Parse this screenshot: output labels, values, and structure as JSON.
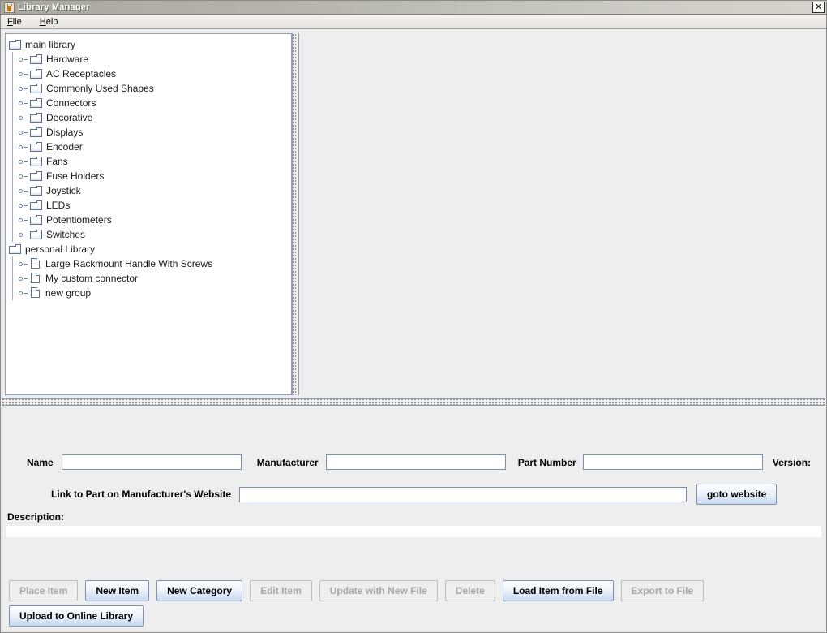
{
  "window": {
    "title": "Library Manager",
    "app_icon": "java-coffee-cup-icon",
    "close_label": "✕"
  },
  "menubar": {
    "items": [
      {
        "label": "File",
        "mnemonic": "F"
      },
      {
        "label": "Help",
        "mnemonic": "H"
      }
    ]
  },
  "tree": {
    "roots": [
      {
        "label": "main library",
        "icon": "folder-icon",
        "children": [
          {
            "label": "Hardware",
            "icon": "folder-icon"
          },
          {
            "label": "AC Receptacles",
            "icon": "folder-icon"
          },
          {
            "label": "Commonly Used Shapes",
            "icon": "folder-icon"
          },
          {
            "label": "Connectors",
            "icon": "folder-icon"
          },
          {
            "label": "Decorative",
            "icon": "folder-icon"
          },
          {
            "label": "Displays",
            "icon": "folder-icon"
          },
          {
            "label": "Encoder",
            "icon": "folder-icon"
          },
          {
            "label": "Fans",
            "icon": "folder-icon"
          },
          {
            "label": "Fuse Holders",
            "icon": "folder-icon"
          },
          {
            "label": "Joystick",
            "icon": "folder-icon"
          },
          {
            "label": "LEDs",
            "icon": "folder-icon"
          },
          {
            "label": "Potentiometers",
            "icon": "folder-icon"
          },
          {
            "label": "Switches",
            "icon": "folder-icon"
          }
        ]
      },
      {
        "label": "personal Library",
        "icon": "folder-icon",
        "children": [
          {
            "label": "Large Rackmount Handle With Screws",
            "icon": "document-icon"
          },
          {
            "label": "My custom connector",
            "icon": "document-icon"
          },
          {
            "label": "new group",
            "icon": "document-icon"
          }
        ]
      }
    ]
  },
  "form": {
    "name_label": "Name",
    "name_value": "",
    "manufacturer_label": "Manufacturer",
    "manufacturer_value": "",
    "part_number_label": "Part Number",
    "part_number_value": "",
    "version_label": "Version:",
    "link_label": "Link to Part on Manufacturer's Website",
    "link_value": "",
    "goto_website_label": "goto website",
    "description_label": "Description:",
    "description_value": ""
  },
  "actions": {
    "row1": [
      {
        "label": "Place Item",
        "enabled": false
      },
      {
        "label": "New Item",
        "enabled": true
      },
      {
        "label": "New Category",
        "enabled": true
      },
      {
        "label": "Edit Item",
        "enabled": false
      },
      {
        "label": "Update with New File",
        "enabled": false
      },
      {
        "label": "Delete",
        "enabled": false
      },
      {
        "label": "Load Item from File",
        "enabled": true
      },
      {
        "label": "Export to File",
        "enabled": false
      }
    ],
    "row2": [
      {
        "label": "Upload to Online Library",
        "enabled": true
      }
    ]
  },
  "colors": {
    "panel_bg": "#eeeeee",
    "tree_bg": "#ffffff",
    "accent_border": "#7d93b0",
    "titlebar_text": "#ffffff",
    "disabled_text": "#a9a9a9"
  }
}
